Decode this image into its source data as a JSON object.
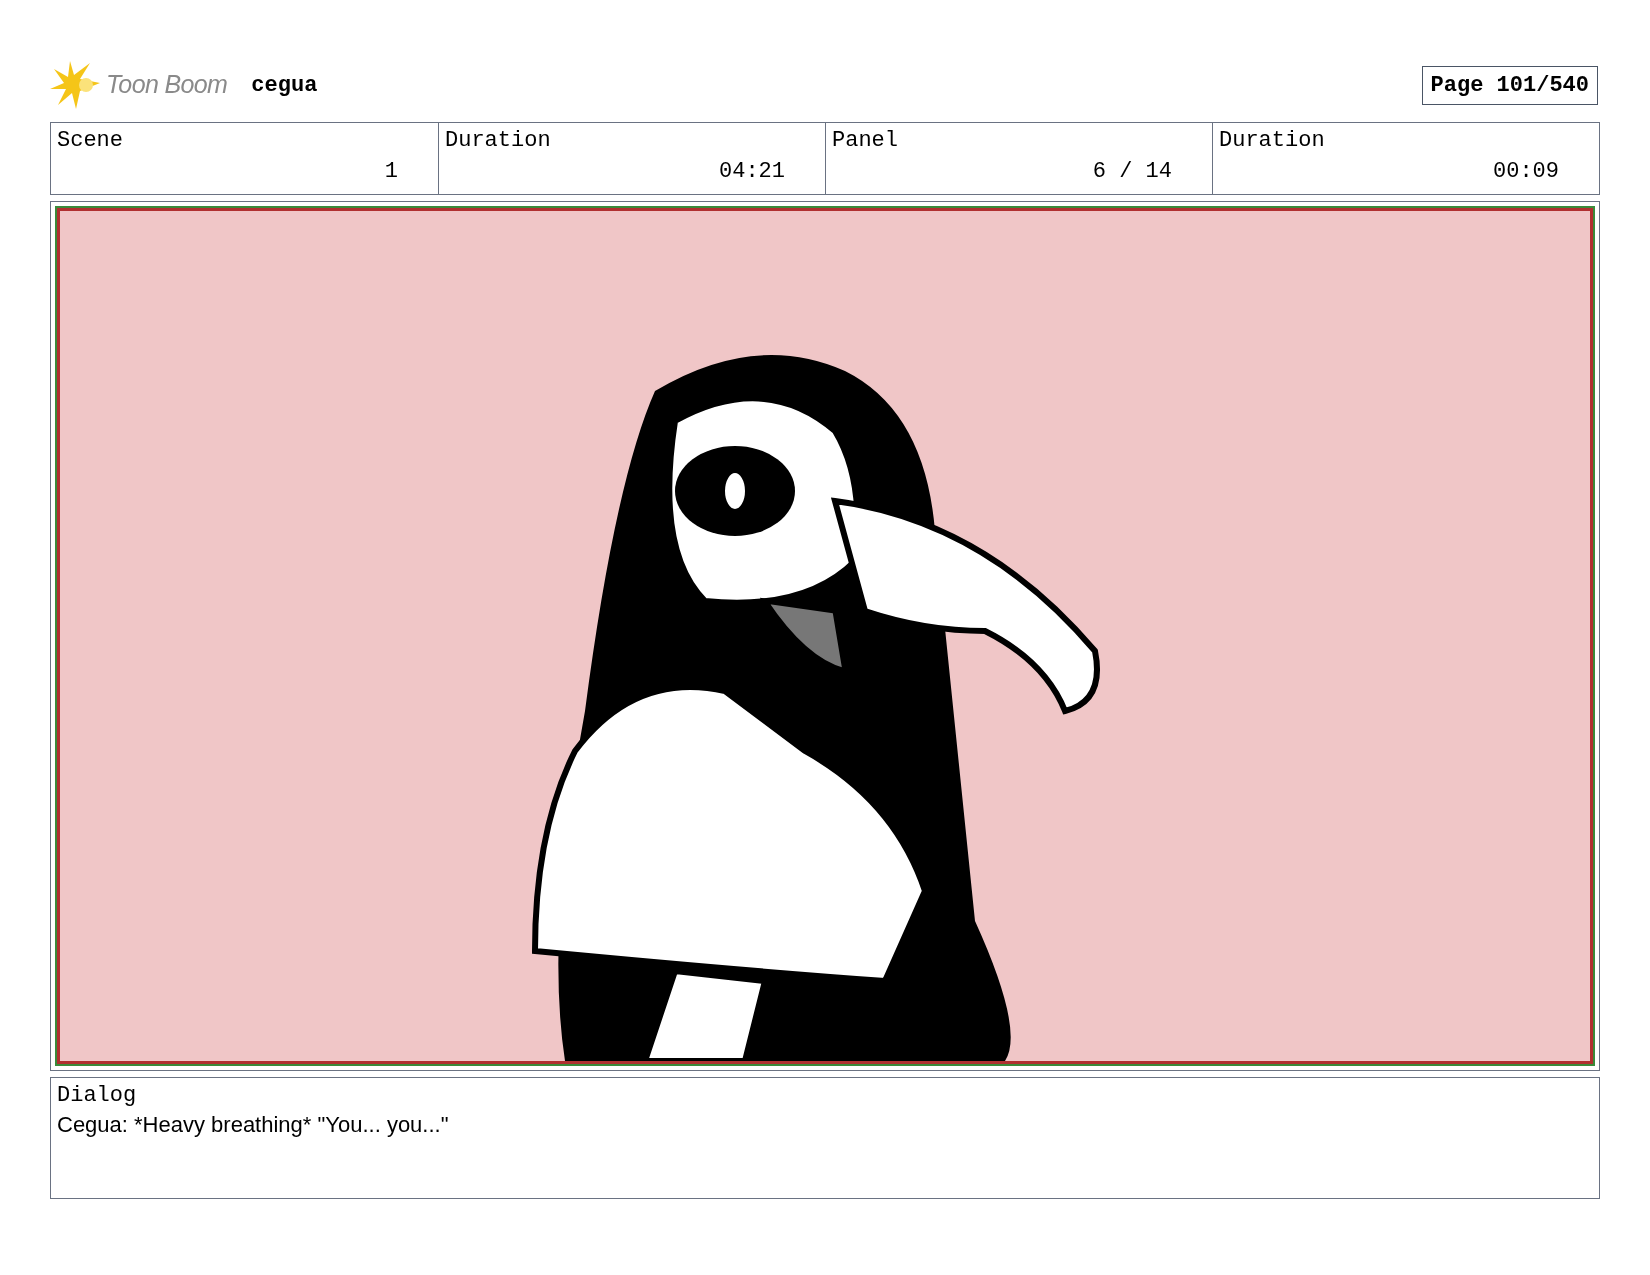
{
  "header": {
    "logo_text": "Toon Boom",
    "project": "cegua",
    "page": "Page 101/540"
  },
  "info": [
    {
      "label": "Scene",
      "value": "1"
    },
    {
      "label": "Duration",
      "value": "04:21"
    },
    {
      "label": "Panel",
      "value": "6 / 14"
    },
    {
      "label": "Duration",
      "value": "00:09"
    }
  ],
  "dialog": {
    "label": "Dialog",
    "text": "Cegua: *Heavy breathing* \"You... you...\""
  }
}
